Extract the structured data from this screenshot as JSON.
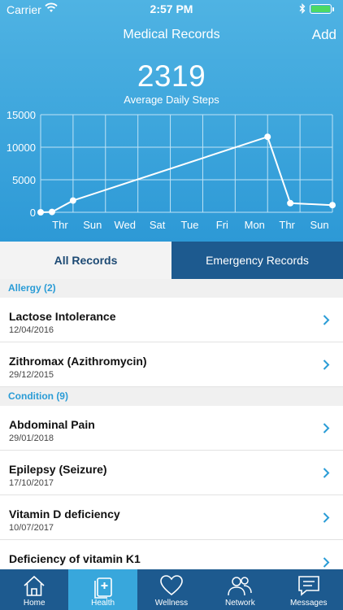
{
  "status_bar": {
    "carrier": "Carrier",
    "time": "2:57 PM"
  },
  "nav": {
    "title": "Medical Records",
    "add_label": "Add"
  },
  "summary": {
    "value": "2319",
    "label": "Average Daily Steps"
  },
  "chart_data": {
    "type": "line",
    "ylim": [
      0,
      15000
    ],
    "y_ticks": [
      "15000",
      "10000",
      "5000",
      "0"
    ],
    "x_ticks": [
      "Thr",
      "Sun",
      "Wed",
      "Sat",
      "Tue",
      "Fri",
      "Mon",
      "Thr",
      "Sun"
    ],
    "points": [
      {
        "x": 0,
        "y": 0
      },
      {
        "x": 0.35,
        "y": 50
      },
      {
        "x": 1.0,
        "y": 1800
      },
      {
        "x": 7.0,
        "y": 11600
      },
      {
        "x": 7.7,
        "y": 1400
      },
      {
        "x": 9.0,
        "y": 1100
      }
    ],
    "grid": true,
    "colors": {
      "line": "#ffffff",
      "grid": "#bfe3f6"
    }
  },
  "segments": {
    "all": "All Records",
    "emergency": "Emergency Records"
  },
  "sections": [
    {
      "title": "Allergy (2)",
      "items": [
        {
          "name": "Lactose Intolerance",
          "date": "12/04/2016"
        },
        {
          "name": "Zithromax (Azithromycin)",
          "date": "29/12/2015"
        }
      ]
    },
    {
      "title": "Condition (9)",
      "items": [
        {
          "name": "Abdominal Pain",
          "date": "29/01/2018"
        },
        {
          "name": "Epilepsy (Seizure)",
          "date": "17/10/2017"
        },
        {
          "name": "Vitamin D deficiency",
          "date": "10/07/2017"
        },
        {
          "name": "Deficiency of vitamin K1",
          "date": ""
        }
      ]
    }
  ],
  "tabs": [
    {
      "label": "Home",
      "icon": "home-icon"
    },
    {
      "label": "Health",
      "icon": "health-record-icon"
    },
    {
      "label": "Wellness",
      "icon": "heart-icon"
    },
    {
      "label": "Network",
      "icon": "people-icon"
    },
    {
      "label": "Messages",
      "icon": "messages-icon"
    }
  ],
  "colors": {
    "accent": "#2a9cd6",
    "nav_dark": "#1d5a8f",
    "tab_active": "#38a7dc"
  }
}
